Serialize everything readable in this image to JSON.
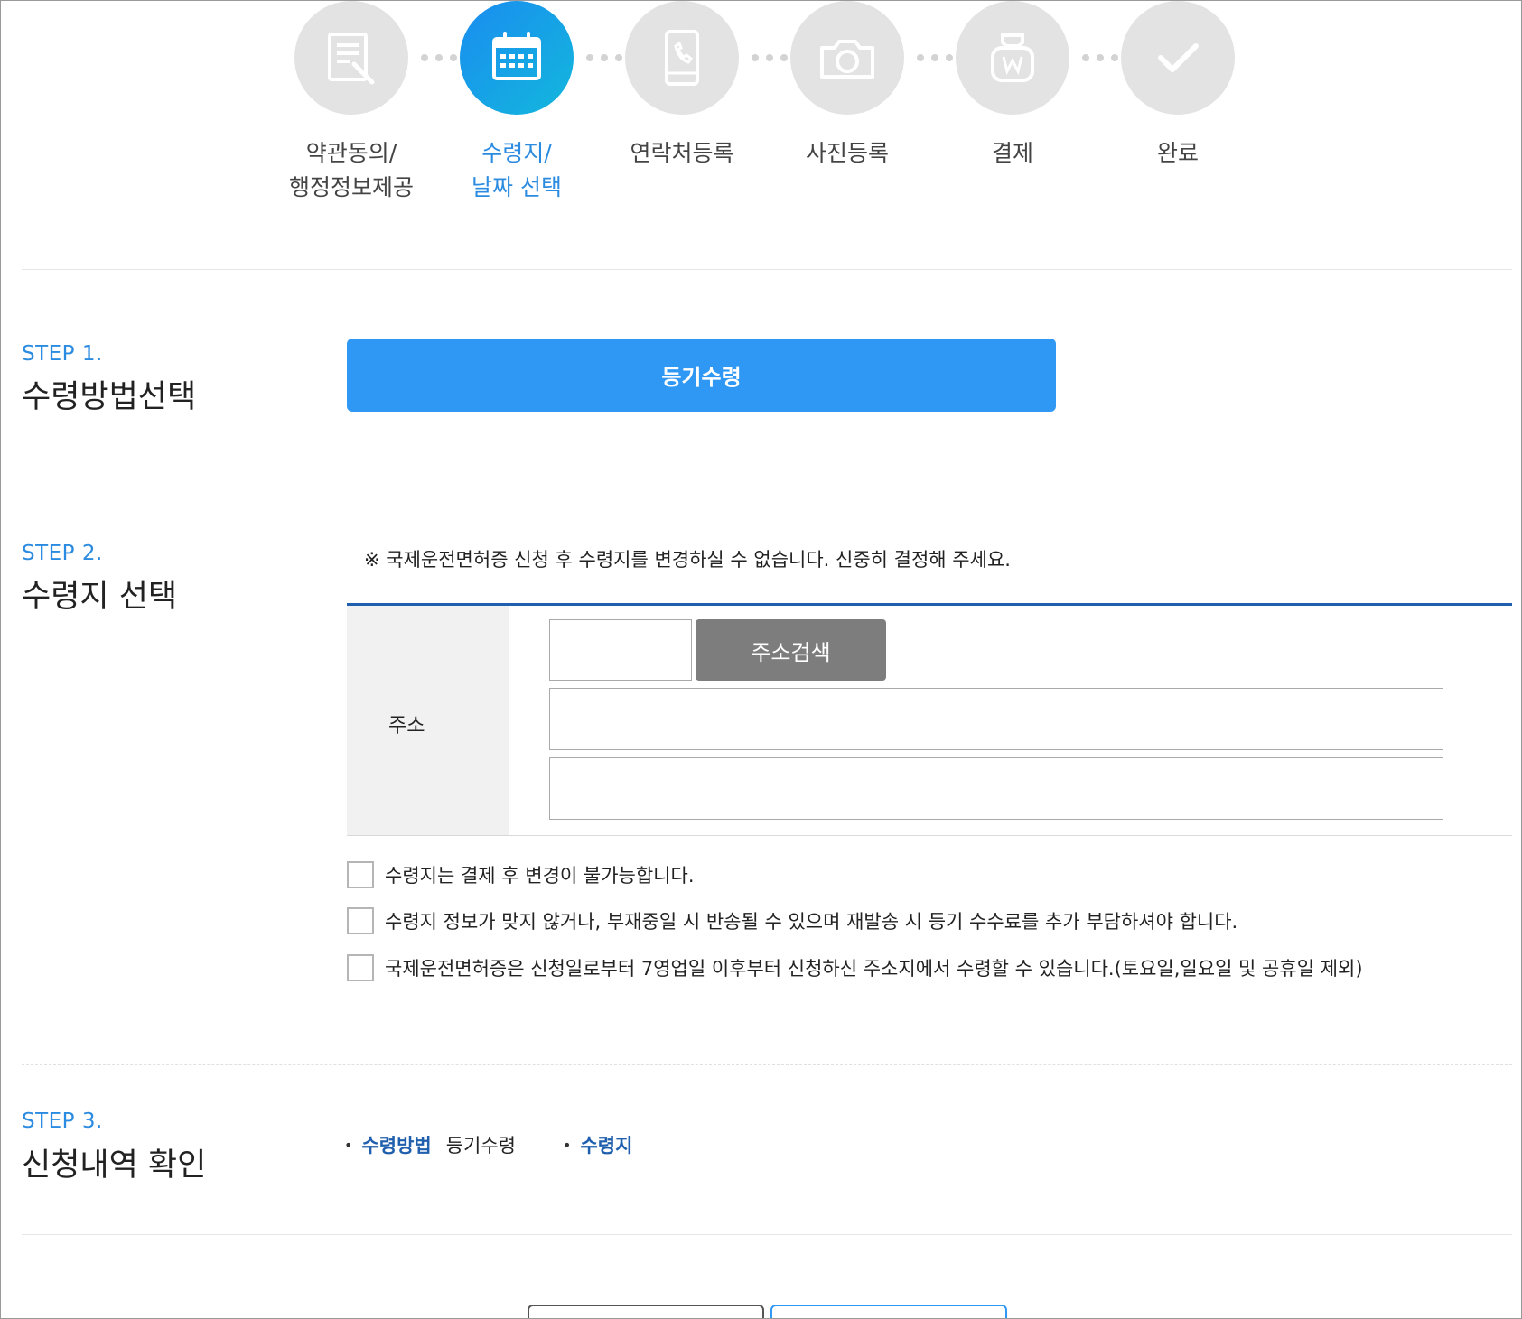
{
  "stepper": [
    {
      "label": "약관동의/\n행정정보제공",
      "icon": "document-edit-icon",
      "active": false
    },
    {
      "label": "수령지/\n날짜 선택",
      "icon": "calendar-icon",
      "active": true
    },
    {
      "label": "연락처등록",
      "icon": "mobile-phone-icon",
      "active": false
    },
    {
      "label": "사진등록",
      "icon": "camera-icon",
      "active": false
    },
    {
      "label": "결제",
      "icon": "won-pouch-icon",
      "active": false
    },
    {
      "label": "완료",
      "icon": "check-icon",
      "active": false
    }
  ],
  "step1": {
    "num": "STEP 1.",
    "title": "수령방법선택",
    "method_button": "등기수령"
  },
  "step2": {
    "num": "STEP 2.",
    "title": "수령지 선택",
    "notice": "※ 국제운전면허증 신청 후 수령지를 변경하실 수 없습니다. 신중히 결정해 주세요.",
    "address_label": "주소",
    "zip_value": "",
    "search_button": "주소검색",
    "address1_value": "",
    "address2_value": "",
    "checks": [
      "수령지는 결제 후 변경이 불가능합니다.",
      "수령지 정보가 맞지 않거나, 부재중일 시 반송될 수 있으며 재발송 시 등기 수수료를 추가 부담하셔야 합니다.",
      "국제운전면허증은 신청일로부터 7영업일 이후부터 신청하신 주소지에서 수령할 수 있습니다.(토요일,일요일 및 공휴일 제외)"
    ]
  },
  "step3": {
    "num": "STEP 3.",
    "title": "신청내역 확인",
    "bullet": "•",
    "method_key": "수령방법",
    "method_value": "등기수령",
    "address_key": "수령지"
  },
  "colors": {
    "accent": "#2f98f5",
    "active_gradient_start": "#1a8cf0",
    "active_gradient_end": "#13b8dc",
    "step_label": "#2b8be0",
    "table_top_border": "#1f5fad",
    "search_button": "#7d7d7d"
  }
}
